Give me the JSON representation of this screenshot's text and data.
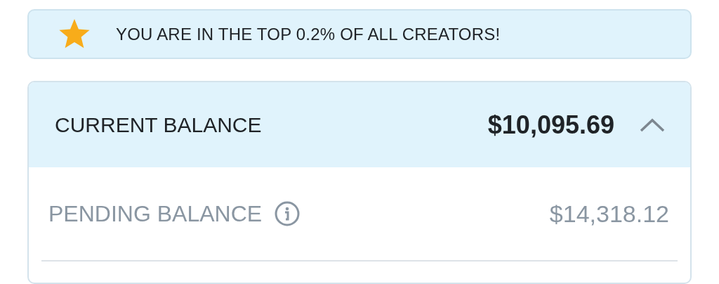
{
  "banner": {
    "text": "YOU ARE IN THE TOP 0.2% OF ALL CREATORS!"
  },
  "balance_card": {
    "expanded": true,
    "current_label": "CURRENT BALANCE",
    "current_amount": "$10,095.69",
    "rows": [
      {
        "label": "PENDING BALANCE",
        "amount": "$14,318.12"
      }
    ]
  }
}
